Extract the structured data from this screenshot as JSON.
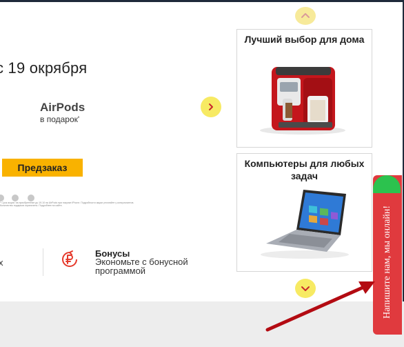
{
  "banner": {
    "title": "с 19 окрября",
    "airpods_title": "AirPods",
    "airpods_subtitle": "в подарок'",
    "preorder_label": "Предзаказ",
    "fine_print": "* Срок акции: на приобретение до 19.10 на AirPods при покупке iPhone. Подробности акции уточняйте у консультантов. Количество подарков ограничено. Подробнее на сайте."
  },
  "navigation": {
    "next_icon": "chevron-right-icon",
    "up_icon": "chevron-up-icon",
    "down_icon": "chevron-down-icon",
    "accent_color": "#f7ea63"
  },
  "cards": [
    {
      "title": "Лучший выбор для дома",
      "image": "coffee-machine-image"
    },
    {
      "title": "Компьютеры для любых задач",
      "image": "laptop-image"
    }
  ],
  "bonus": {
    "left_partial": "х",
    "title": "Бонусы",
    "text": "Экономьте с бонусной программой",
    "icon": "bonus-ruble-icon",
    "icon_color": "#e53a2c"
  },
  "chat": {
    "label": "Напишите нам, мы онлайн!",
    "tab_color": "#e03a3e",
    "status_color": "#2cc24e"
  },
  "colors": {
    "preorder_button": "#f9b200",
    "footer_gray": "#ededed",
    "annotation_arrow": "#b30b12"
  }
}
